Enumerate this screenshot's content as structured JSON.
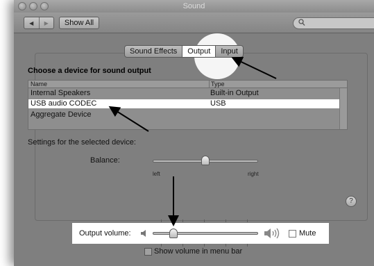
{
  "window": {
    "title": "Sound"
  },
  "toolbar": {
    "back_glyph": "◀",
    "forward_glyph": "▶",
    "show_all_label": "Show All",
    "search_placeholder": ""
  },
  "tabs": [
    {
      "label": "Sound Effects",
      "selected": false
    },
    {
      "label": "Output",
      "selected": true
    },
    {
      "label": "Input",
      "selected": false
    }
  ],
  "output": {
    "heading": "Choose a device for sound output",
    "columns": [
      "Name",
      "Type"
    ],
    "rows": [
      {
        "name": "Internal Speakers",
        "type": "Built-in Output",
        "selected": false
      },
      {
        "name": "USB audio CODEC",
        "type": "USB",
        "selected": true
      },
      {
        "name": "Aggregate Device",
        "type": "",
        "selected": false
      }
    ],
    "settings_label": "Settings for the selected device:",
    "balance": {
      "label": "Balance:",
      "left": "left",
      "right": "right",
      "value": 0.5
    }
  },
  "help_glyph": "?",
  "volume": {
    "label": "Output volume:",
    "value": 0.2,
    "mute_label": "Mute",
    "muted": false
  },
  "menu_bar_option": {
    "label": "Show volume in menu bar",
    "checked": false
  },
  "icons": {
    "back": "back-arrow-icon",
    "forward": "forward-arrow-icon",
    "search": "search-icon",
    "help": "help-icon",
    "speaker_low": "speaker-low-icon",
    "speaker_high": "speaker-high-icon"
  }
}
